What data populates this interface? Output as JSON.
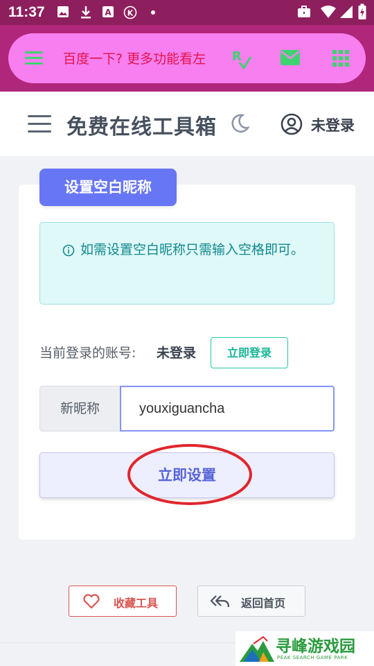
{
  "status_bar": {
    "time": "11:37",
    "icons": [
      "image-icon",
      "download-icon",
      "a-app-icon",
      "k-app-icon",
      "dot-icon",
      "briefcase-icon",
      "wifi-icon",
      "signal-icon",
      "battery-icon"
    ]
  },
  "top_bar": {
    "marquee_text": "百度一下?  更多功能看左",
    "icons": [
      "menu-icon",
      "rx-icon",
      "mail-icon",
      "grid-icon"
    ],
    "pill_color": "#f77ff0",
    "band_color": "#b0267a"
  },
  "header": {
    "title": "免费在线工具箱",
    "login_status": "未登录"
  },
  "card": {
    "tag": "设置空白昵称",
    "info_text": "如需设置空白昵称只需输入空格即可。",
    "account_label": "当前登录的账号:",
    "account_value": "未登录",
    "login_button": "立即登录",
    "nickname_label": "新昵称",
    "nickname_value": "youxiguancha",
    "set_button": "立即设置"
  },
  "footer": {
    "favorite_button": "收藏工具",
    "home_button": "返回首页"
  },
  "watermark": {
    "title": "寻峰游戏园",
    "subtitle": "PEAK SEARCH GAME PARK"
  },
  "colors": {
    "accent": "#6776f4",
    "teal": "#16b497",
    "danger": "#d9534f",
    "annotation_red": "#e0262d"
  }
}
